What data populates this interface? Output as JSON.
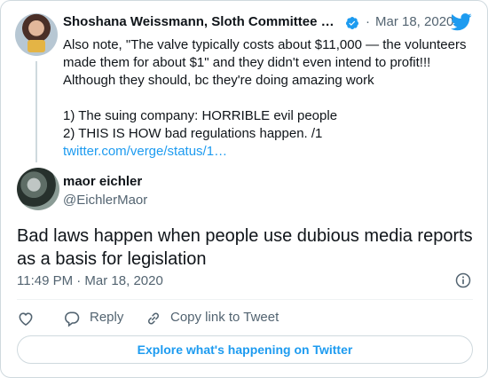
{
  "parent_tweet": {
    "author_name": "Shoshana Weissmann, Sloth Committee …",
    "separator": "·",
    "date": "Mar 18, 2020",
    "lines": [
      "Also note, \"The valve typically costs about $11,000 — the volunteers",
      "made them for about $1\" and they didn't even intend to profit!!!",
      "Although they should, bc they're doing amazing work",
      "",
      "1) The suing company: HORRIBLE evil people",
      "2) THIS IS HOW bad regulations happen. /1"
    ],
    "link_text": "twitter.com/verge/status/1…"
  },
  "main_tweet": {
    "author_name": "maor eichler",
    "handle": "@EichlerMaor",
    "text": "Bad laws happen when people use dubious media reports as a basis for legislation",
    "time": "11:49 PM · Mar 18, 2020"
  },
  "actions": {
    "reply_label": "Reply",
    "copy_link_label": "Copy link to Tweet"
  },
  "explore_label": "Explore what's happening on Twitter",
  "colors": {
    "accent": "#1d9bf0",
    "text": "#0f1419",
    "muted": "#536471",
    "border": "#cfd9de"
  },
  "icons": [
    "verified-badge-icon",
    "twitter-bird-icon",
    "info-icon",
    "heart-icon",
    "reply-icon",
    "link-icon"
  ]
}
